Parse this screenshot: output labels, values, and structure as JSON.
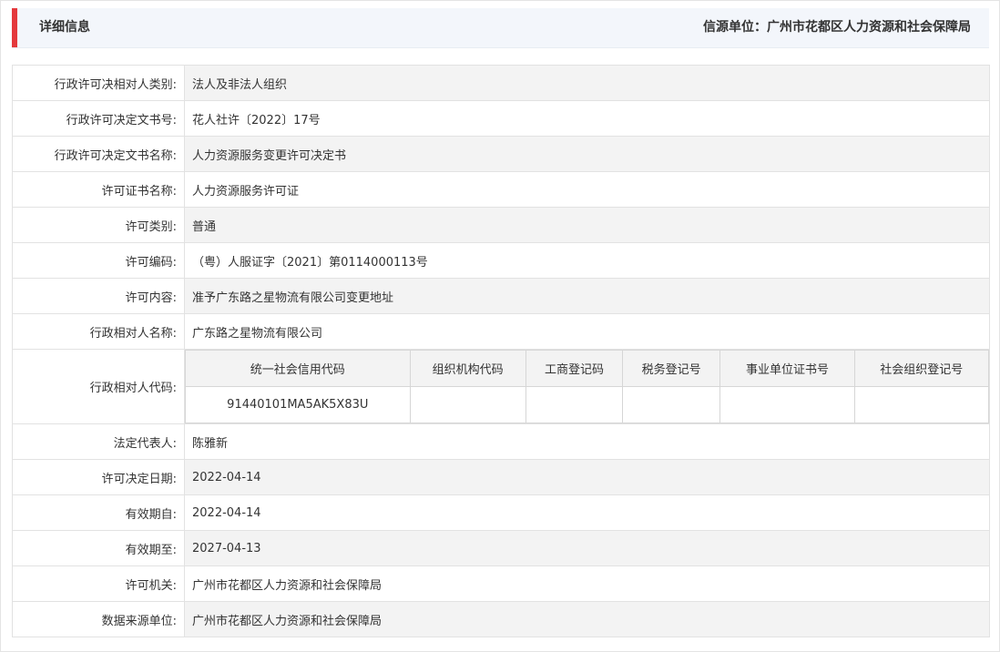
{
  "header": {
    "title": "详细信息",
    "source": "信源单位：广州市花都区人力资源和社会保障局"
  },
  "rows": [
    {
      "label": "行政许可决相对人类别:",
      "value": "法人及非法人组织"
    },
    {
      "label": "行政许可决定文书号:",
      "value": "花人社许〔2022〕17号"
    },
    {
      "label": "行政许可决定文书名称:",
      "value": "人力资源服务变更许可决定书"
    },
    {
      "label": "许可证书名称:",
      "value": "人力资源服务许可证"
    },
    {
      "label": "许可类别:",
      "value": "普通"
    },
    {
      "label": "许可编码:",
      "value": "（粤）人服证字〔2021〕第0114000113号"
    },
    {
      "label": "许可内容:",
      "value": "准予广东路之星物流有限公司变更地址"
    },
    {
      "label": "行政相对人名称:",
      "value": "广东路之星物流有限公司"
    }
  ],
  "codes": {
    "label": "行政相对人代码:",
    "headers": [
      "统一社会信用代码",
      "组织机构代码",
      "工商登记码",
      "税务登记号",
      "事业单位证书号",
      "社会组织登记号"
    ],
    "values": [
      "91440101MA5AK5X83U",
      "",
      "",
      "",
      "",
      ""
    ]
  },
  "rows2": [
    {
      "label": "法定代表人:",
      "value": "陈雅新"
    },
    {
      "label": "许可决定日期:",
      "value": "2022-04-14"
    },
    {
      "label": "有效期自:",
      "value": "2022-04-14"
    },
    {
      "label": "有效期至:",
      "value": "2027-04-13"
    },
    {
      "label": "许可机关:",
      "value": "广州市花都区人力资源和社会保障局"
    },
    {
      "label": "数据来源单位:",
      "value": "广州市花都区人力资源和社会保障局"
    }
  ]
}
